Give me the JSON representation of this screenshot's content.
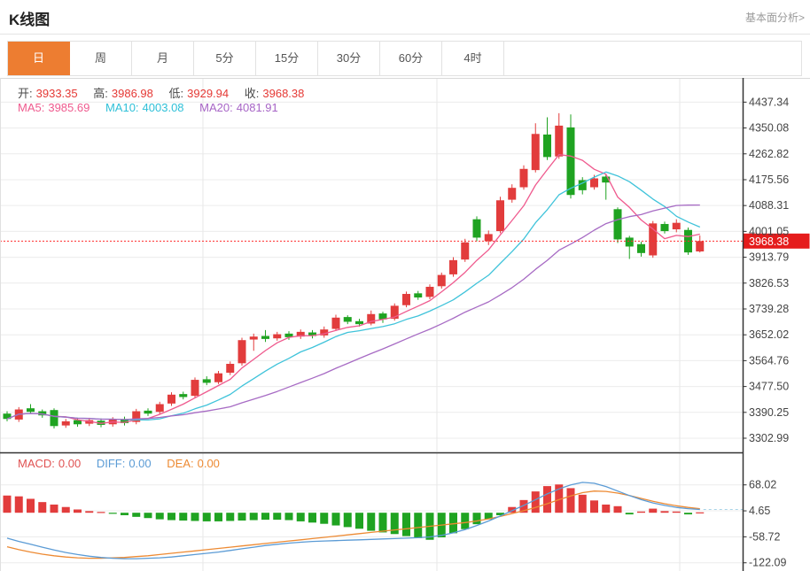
{
  "header": {
    "title": "K线图",
    "link": "基本面分析>"
  },
  "tabs": {
    "active_index": 0,
    "items": [
      {
        "label": "日",
        "slug": "day"
      },
      {
        "label": "周",
        "slug": "week"
      },
      {
        "label": "月",
        "slug": "month"
      },
      {
        "label": "5分",
        "slug": "min5"
      },
      {
        "label": "15分",
        "slug": "min15"
      },
      {
        "label": "30分",
        "slug": "min30"
      },
      {
        "label": "60分",
        "slug": "min60"
      },
      {
        "label": "4时",
        "slug": "hour4"
      }
    ]
  },
  "ohlc_legend": {
    "open_label": "开:",
    "open": "3933.35",
    "high_label": "高:",
    "high": "3986.98",
    "low_label": "低:",
    "low": "3929.94",
    "close_label": "收:",
    "close": "3968.38"
  },
  "ma_legend": {
    "ma5_label": "MA5:",
    "ma5": "3985.69",
    "ma10_label": "MA10:",
    "ma10": "4003.08",
    "ma20_label": "MA20:",
    "ma20": "4081.91"
  },
  "macd_legend": {
    "macd_label": "MACD:",
    "macd": "0.00",
    "diff_label": "DIFF:",
    "diff": "0.00",
    "dea_label": "DEA:",
    "dea": "0.00"
  },
  "price_marker": {
    "label": "3968.38",
    "price": 3968.38
  },
  "colors": {
    "up": "#e23c3c",
    "down": "#1fa321",
    "ma5": "#ef5a8e",
    "ma10": "#3fc3da",
    "ma20": "#a76bc4",
    "diff_line": "#5b9bd5",
    "dea_line": "#ed8a33",
    "accent": "#ed7d31",
    "marker_bg": "#e51c1c",
    "dotted_price_line": "#ff2d2d",
    "macd_current_dash": "#a8d4e8",
    "axis_line": "#333333",
    "grid": "#ececec",
    "tick_text": "#444444"
  },
  "chart_data": [
    {
      "type": "candlestick",
      "title": "K线图 (daily)",
      "legend_position": "top-left",
      "grid": true,
      "y_ticks": [
        "4437.34",
        "4350.08",
        "4262.82",
        "4175.56",
        "4088.31",
        "4001.05",
        "3913.79",
        "3826.53",
        "3739.28",
        "3652.02",
        "3564.76",
        "3477.50",
        "3390.25",
        "3302.99"
      ],
      "current_price": 3968.38,
      "ma_periods": [
        5,
        10,
        20
      ],
      "candles_ohlc": [
        [
          3386,
          3394,
          3360,
          3368
        ],
        [
          3366,
          3408,
          3358,
          3400
        ],
        [
          3404,
          3418,
          3386,
          3392
        ],
        [
          3394,
          3400,
          3372,
          3380
        ],
        [
          3398,
          3404,
          3336,
          3344
        ],
        [
          3346,
          3368,
          3338,
          3360
        ],
        [
          3364,
          3372,
          3342,
          3350
        ],
        [
          3352,
          3372,
          3344,
          3364
        ],
        [
          3362,
          3370,
          3340,
          3348
        ],
        [
          3350,
          3374,
          3342,
          3366
        ],
        [
          3368,
          3376,
          3346,
          3354
        ],
        [
          3358,
          3402,
          3350,
          3394
        ],
        [
          3396,
          3404,
          3378,
          3386
        ],
        [
          3392,
          3426,
          3384,
          3418
        ],
        [
          3420,
          3458,
          3412,
          3450
        ],
        [
          3452,
          3460,
          3434,
          3442
        ],
        [
          3446,
          3508,
          3438,
          3500
        ],
        [
          3502,
          3512,
          3482,
          3490
        ],
        [
          3492,
          3530,
          3486,
          3522
        ],
        [
          3524,
          3562,
          3516,
          3554
        ],
        [
          3556,
          3642,
          3548,
          3634
        ],
        [
          3636,
          3656,
          3598,
          3646
        ],
        [
          3648,
          3668,
          3628,
          3638
        ],
        [
          3640,
          3662,
          3632,
          3654
        ],
        [
          3656,
          3664,
          3635,
          3644
        ],
        [
          3646,
          3670,
          3638,
          3662
        ],
        [
          3660,
          3668,
          3640,
          3648
        ],
        [
          3650,
          3680,
          3642,
          3670
        ],
        [
          3672,
          3720,
          3665,
          3710
        ],
        [
          3712,
          3718,
          3688,
          3696
        ],
        [
          3698,
          3706,
          3680,
          3688
        ],
        [
          3690,
          3734,
          3684,
          3722
        ],
        [
          3724,
          3730,
          3692,
          3704
        ],
        [
          3706,
          3758,
          3700,
          3750
        ],
        [
          3752,
          3798,
          3745,
          3790
        ],
        [
          3792,
          3800,
          3770,
          3778
        ],
        [
          3780,
          3822,
          3772,
          3814
        ],
        [
          3816,
          3862,
          3808,
          3854
        ],
        [
          3856,
          3914,
          3848,
          3904
        ],
        [
          3906,
          3976,
          3898,
          3964
        ],
        [
          4042,
          4052,
          3968,
          3980
        ],
        [
          3968,
          4004,
          3955,
          3992
        ],
        [
          4002,
          4118,
          3995,
          4106
        ],
        [
          4108,
          4160,
          4098,
          4148
        ],
        [
          4150,
          4224,
          4142,
          4212
        ],
        [
          4208,
          4366,
          4200,
          4330
        ],
        [
          4328,
          4386,
          4242,
          4252
        ],
        [
          4254,
          4400,
          4246,
          4358
        ],
        [
          4352,
          4396,
          4112,
          4124
        ],
        [
          4174,
          4184,
          4126,
          4140
        ],
        [
          4150,
          4192,
          4142,
          4180
        ],
        [
          4186,
          4194,
          4108,
          4166
        ],
        [
          4076,
          4082,
          3962,
          3974
        ],
        [
          3980,
          3986,
          3908,
          3950
        ],
        [
          3958,
          3966,
          3916,
          3928
        ],
        [
          3920,
          4036,
          3912,
          4028
        ],
        [
          4026,
          4034,
          3994,
          4002
        ],
        [
          4008,
          4042,
          3998,
          4030
        ],
        [
          4006,
          4014,
          3922,
          3930
        ],
        [
          3933.35,
          3986.98,
          3929.94,
          3968.38
        ]
      ]
    },
    {
      "type": "bar",
      "title": "MACD(12,26,9)",
      "y_ticks": [
        "68.02",
        "4.65",
        "-58.72",
        "-122.09"
      ],
      "series": [
        {
          "name": "MACD histogram",
          "values": [
            42,
            40,
            34,
            26,
            20,
            14,
            8,
            4,
            2,
            -2,
            -6,
            -10,
            -13,
            -16,
            -18,
            -19,
            -20,
            -21,
            -21,
            -20,
            -19,
            -18,
            -17,
            -17,
            -18,
            -21,
            -24,
            -27,
            -31,
            -35,
            -39,
            -44,
            -48,
            -52,
            -57,
            -62,
            -66,
            -60,
            -50,
            -40,
            -28,
            -16,
            -6,
            14,
            31,
            52,
            65,
            69,
            60,
            44,
            30,
            20,
            16,
            -4,
            3,
            10,
            4,
            3,
            -4,
            1
          ]
        },
        {
          "name": "DIFF",
          "values": [
            -62,
            -70,
            -77,
            -84,
            -91,
            -97,
            -102,
            -106,
            -109,
            -111,
            -112,
            -112,
            -111,
            -110,
            -108,
            -105,
            -102,
            -99,
            -96,
            -92,
            -88,
            -84,
            -80,
            -77,
            -74,
            -72,
            -70,
            -69,
            -68,
            -67,
            -66,
            -65,
            -64,
            -63,
            -62,
            -61,
            -59,
            -55,
            -49,
            -41,
            -31,
            -20,
            -8,
            5,
            18,
            32,
            46,
            58,
            68,
            74,
            72,
            64,
            53,
            42,
            32,
            24,
            18,
            13,
            10,
            8
          ]
        },
        {
          "name": "DEA",
          "values": [
            -83,
            -90,
            -96,
            -101,
            -105,
            -108,
            -110,
            -111,
            -111,
            -110,
            -109,
            -107,
            -105,
            -102,
            -99,
            -96,
            -93,
            -90,
            -87,
            -84,
            -81,
            -78,
            -75,
            -72,
            -69,
            -66,
            -63,
            -60,
            -57,
            -54,
            -51,
            -48,
            -45,
            -42,
            -39,
            -36,
            -33,
            -30,
            -27,
            -24,
            -20,
            -15,
            -9,
            -2,
            5,
            13,
            22,
            32,
            41,
            49,
            53,
            52,
            48,
            42,
            35,
            28,
            22,
            17,
            13,
            10
          ]
        }
      ]
    }
  ]
}
